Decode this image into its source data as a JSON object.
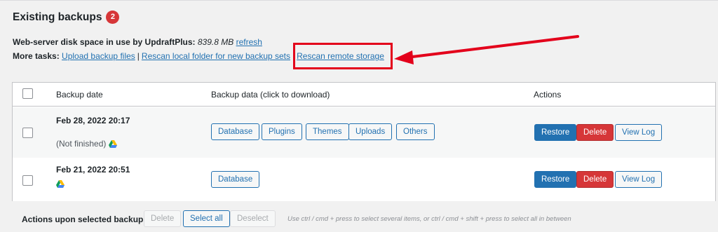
{
  "heading": {
    "title": "Existing backups",
    "count": "2"
  },
  "disk": {
    "label": "Web-server disk space in use by UpdraftPlus:",
    "value": "839.8 MB",
    "refresh_link": "refresh"
  },
  "tasks": {
    "label": "More tasks:",
    "links": [
      "Upload backup files",
      "Rescan local folder for new backup sets",
      "Rescan remote storage"
    ],
    "separator": "|"
  },
  "table": {
    "headers": {
      "date": "Backup date",
      "data": "Backup data (click to download)",
      "actions": "Actions"
    },
    "rows": [
      {
        "date": "Feb 28, 2022 20:17",
        "note": "(Not finished)",
        "storage_icon": "google-drive-icon",
        "data_buttons": [
          "Database",
          "Plugins",
          "Themes",
          "Uploads",
          "Others"
        ],
        "actions": [
          "Restore",
          "Delete",
          "View Log"
        ]
      },
      {
        "date": "Feb 21, 2022 20:51",
        "note": "",
        "storage_icon": "google-drive-icon",
        "data_buttons": [
          "Database"
        ],
        "actions": [
          "Restore",
          "Delete",
          "View Log"
        ]
      }
    ]
  },
  "bulk": {
    "label": "Actions upon selected backups",
    "buttons": [
      "Delete",
      "Select all",
      "Deselect"
    ],
    "hint": "Use ctrl / cmd + press to select several items, or ctrl / cmd + shift + press to select all in between"
  },
  "colors": {
    "accent": "#2271b1",
    "danger": "#d63638",
    "annotation": "#e3001b"
  }
}
